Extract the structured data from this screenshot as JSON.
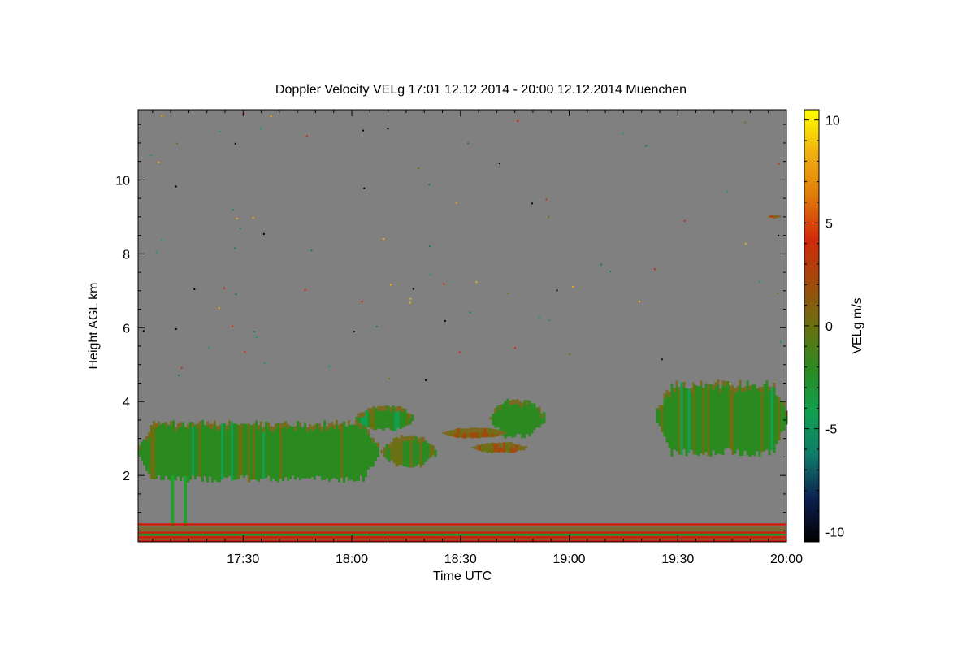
{
  "chart_data": {
    "type": "heatmap",
    "title": "Doppler Velocity VELg   17:01 12.12.2014 - 20:00 12.12.2014 Muenchen",
    "xlabel": "Time UTC",
    "ylabel": "Height AGL km",
    "x_ticks": [
      "17:30",
      "18:00",
      "18:30",
      "19:00",
      "19:30",
      "20:00"
    ],
    "x_tick_minutes": [
      1050,
      1080,
      1110,
      1140,
      1170,
      1200
    ],
    "xlim_minutes": [
      1021,
      1200
    ],
    "y_ticks": [
      2,
      4,
      6,
      8,
      10
    ],
    "ylim": [
      0.2,
      11.9
    ],
    "colorbar": {
      "label": "VELg m/s",
      "ticks": [
        10,
        5,
        0,
        -5,
        -10
      ],
      "range": [
        -10.5,
        10.5
      ],
      "colors": [
        "#000000",
        "#0c2050",
        "#0f7a6a",
        "#10a050",
        "#2a8a20",
        "#6a7010",
        "#a04a0a",
        "#d02a0a",
        "#e07a0a",
        "#f0b010",
        "#ffff00"
      ]
    },
    "background_color": "#808080",
    "echo_regions": [
      {
        "name": "low-level cloud",
        "t_start": 1021,
        "t_end": 1087,
        "h_bottom": 1.8,
        "h_top": 3.5,
        "mean_velocity": -2
      },
      {
        "name": "cloud patch 18:00",
        "t_start": 1081,
        "t_end": 1097,
        "h_bottom": 3.2,
        "h_top": 3.9,
        "mean_velocity": -2
      },
      {
        "name": "cloud patch 18:05",
        "t_start": 1088,
        "t_end": 1103,
        "h_bottom": 2.2,
        "h_top": 3.1,
        "mean_velocity": -1
      },
      {
        "name": "cloud patch 18:30",
        "t_start": 1118,
        "t_end": 1133,
        "h_bottom": 3.0,
        "h_top": 4.1,
        "mean_velocity": -2
      },
      {
        "name": "layer 18:20",
        "t_start": 1105,
        "t_end": 1122,
        "h_bottom": 3.0,
        "h_top": 3.3,
        "mean_velocity": 2
      },
      {
        "name": "layer 18:35",
        "t_start": 1113,
        "t_end": 1128,
        "h_bottom": 2.6,
        "h_top": 2.9,
        "mean_velocity": 1
      },
      {
        "name": "cloud 19:25-20:00",
        "t_start": 1164,
        "t_end": 1200,
        "h_bottom": 2.5,
        "h_top": 4.6,
        "mean_velocity": -2
      },
      {
        "name": "cirrus fragment",
        "t_start": 1195,
        "t_end": 1198,
        "h_bottom": 8.9,
        "h_top": 9.1,
        "mean_velocity": 4
      },
      {
        "name": "surface clutter",
        "t_start": 1021,
        "t_end": 1200,
        "h_bottom": 0.2,
        "h_top": 0.7,
        "mean_velocity": 2
      }
    ]
  }
}
